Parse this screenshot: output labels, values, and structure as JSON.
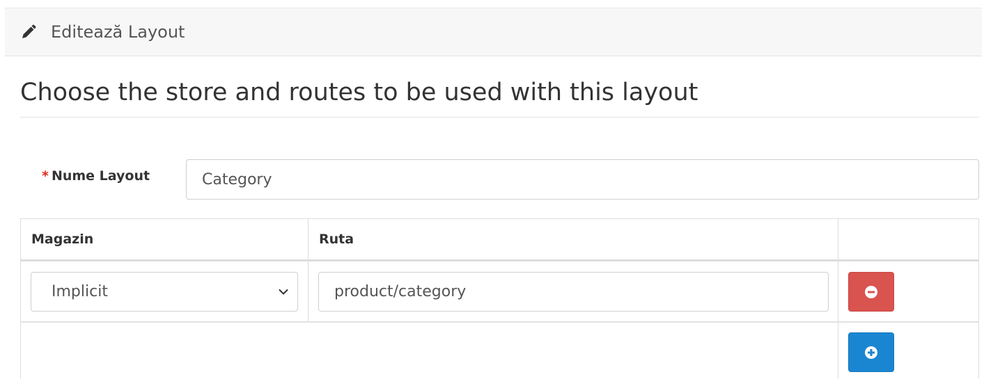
{
  "panel": {
    "title": "Editează Layout",
    "icon": "pencil-icon"
  },
  "legend": "Choose the store and routes to be used with this layout",
  "form": {
    "required_mark": "*",
    "name_label": "Nume Layout",
    "name_value": "Category"
  },
  "route_table": {
    "headers": [
      "Magazin",
      "Ruta",
      ""
    ],
    "rows": [
      {
        "store": "Implicit",
        "route": "product/category"
      }
    ]
  },
  "colors": {
    "danger": "#d9534f",
    "primary": "#1a86d1",
    "required": "#e3261b"
  },
  "icons": {
    "remove": "minus-circle-icon",
    "add": "plus-circle-icon",
    "dropdown": "chevron-down-icon"
  }
}
